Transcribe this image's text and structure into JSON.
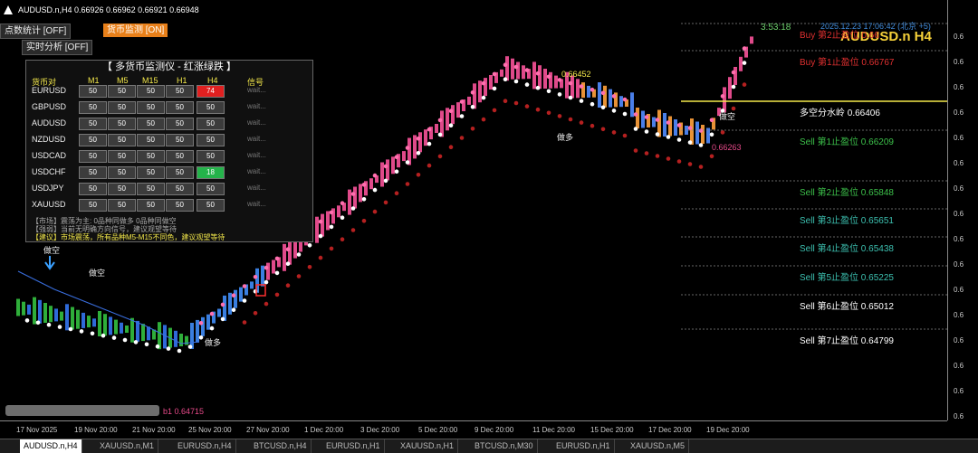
{
  "window": {
    "title": "AUDUSD.n,H4  0.66926 0.66962 0.66921 0.66948"
  },
  "buttons": {
    "stats": "点数统计 [OFF]",
    "monitor": "货币监测 [ON]",
    "analysis": "实时分析 [OFF]"
  },
  "panel": {
    "title": "【 多货币监测仪 - 红涨绿跌 】",
    "headers": [
      "货币对",
      "M1",
      "M5",
      "M15",
      "H1",
      "H4",
      "信号"
    ],
    "rows": [
      {
        "pair": "EURUSD",
        "vals": [
          "50",
          "50",
          "50",
          "50",
          "74"
        ],
        "signal": "wait..."
      },
      {
        "pair": "GBPUSD",
        "vals": [
          "50",
          "50",
          "50",
          "50",
          "50"
        ],
        "signal": "wait..."
      },
      {
        "pair": "AUDUSD",
        "vals": [
          "50",
          "50",
          "50",
          "50",
          "50"
        ],
        "signal": "wait..."
      },
      {
        "pair": "NZDUSD",
        "vals": [
          "50",
          "50",
          "50",
          "50",
          "50"
        ],
        "signal": "wait..."
      },
      {
        "pair": "USDCAD",
        "vals": [
          "50",
          "50",
          "50",
          "50",
          "50"
        ],
        "signal": "wait..."
      },
      {
        "pair": "USDCHF",
        "vals": [
          "50",
          "50",
          "50",
          "50",
          "18"
        ],
        "signal": "wait..."
      },
      {
        "pair": "USDJPY",
        "vals": [
          "50",
          "50",
          "50",
          "50",
          "50"
        ],
        "signal": "wait..."
      },
      {
        "pair": "XAUUSD",
        "vals": [
          "50",
          "50",
          "50",
          "50",
          "50"
        ],
        "signal": "wait..."
      }
    ],
    "notes": [
      "【市场】震荡为主: 0品种同做多 0品种同做空",
      "【强弱】当前无明确方向信号，建议观望等待",
      "【建议】市场震荡，所有品种M5-M15不同色，建议观望等待"
    ]
  },
  "header": {
    "symbol": "AUDUSD.n H4",
    "timer": "3:53:18",
    "timestamp": "2025.12.23 17:06:42 (北京 +5)"
  },
  "levels": [
    {
      "label": "Buy 第2止盈位 0.66",
      "color": "#e03030"
    },
    {
      "label": "Buy 第1止盈位 0.66767",
      "color": "#e03030"
    },
    {
      "label": "多空分水岭 0.66406",
      "color": "#ffffff"
    },
    {
      "label": "Sell 第1止盈位 0.66209",
      "color": "#3cc04a"
    },
    {
      "label": "Sell 第2止盈位 0.65848",
      "color": "#3cc04a"
    },
    {
      "label": "Sell 第3止盈位 0.65651",
      "color": "#3cc0b0"
    },
    {
      "label": "Sell 第4止盈位 0.65438",
      "color": "#3cc0b0"
    },
    {
      "label": "Sell 第5止盈位 0.65225",
      "color": "#3cc0b0"
    },
    {
      "label": "Sell 第6止盈位 0.65012",
      "color": "#ffffff"
    },
    {
      "label": "Sell 第7止盈位 0.64799",
      "color": "#ffffff"
    }
  ],
  "annotations": {
    "short1": "做空",
    "short2": "做空",
    "long1": "做多",
    "long2": "做多",
    "short3": "做空",
    "peak": "0.66452",
    "low": "b1 0.64715",
    "recent": "0.66263"
  },
  "price_axis": [
    "0.6",
    "0.6",
    "0.6",
    "0.6",
    "0.6",
    "0.6",
    "0.6",
    "0.6",
    "0.6",
    "0.6",
    "0.6",
    "0.6",
    "0.6",
    "0.6",
    "0.6",
    "0.6"
  ],
  "time_axis": [
    "17 Nov 2025",
    "19 Nov 20:00",
    "21 Nov 20:00",
    "25 Nov 20:00",
    "27 Nov 20:00",
    "1 Dec 20:00",
    "3 Dec 20:00",
    "5 Dec 20:00",
    "9 Dec 20:00",
    "11 Dec 20:00",
    "15 Dec 20:00",
    "17 Dec 20:00",
    "19 Dec 20:00"
  ],
  "tabs": [
    "AUDUSD.n,H4",
    "XAUUSD.n,M1",
    "EURUSD.n,H4",
    "BTCUSD.n,H4",
    "EURUSD.n,H1",
    "XAUUSD.n,H1",
    "BTCUSD.n,M30",
    "EURUSD.n,H1",
    "XAUUSD.n,M5"
  ]
}
